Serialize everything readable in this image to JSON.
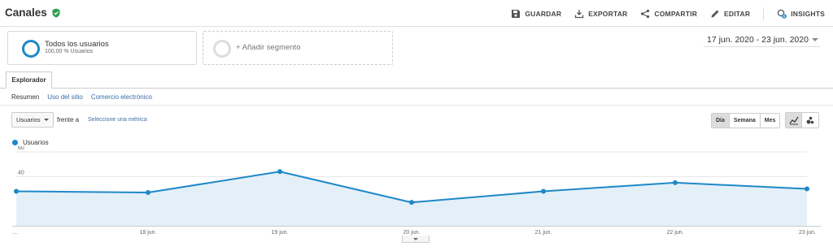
{
  "header": {
    "title": "Canales",
    "actions": [
      {
        "label": "GUARDAR",
        "icon": "save-icon"
      },
      {
        "label": "EXPORTAR",
        "icon": "export-icon"
      },
      {
        "label": "COMPARTIR",
        "icon": "share-icon"
      },
      {
        "label": "EDITAR",
        "icon": "edit-icon"
      },
      {
        "label": "INSIGHTS",
        "icon": "insights-icon",
        "badge": "5"
      }
    ]
  },
  "segments": {
    "active": {
      "title": "Todos los usuarios",
      "subtitle": "100,00 % Usuarios"
    },
    "add_label": "+ Añadir segmento"
  },
  "date_range": "17 jun. 2020 - 23 jun. 2020",
  "tab": "Explorador",
  "subtabs": [
    "Resumen",
    "Uso del sitio",
    "Comercio electrónico"
  ],
  "controls": {
    "metric": "Usuarios",
    "versus": "frente a",
    "pick_metric": "Seleccione una métrica",
    "period": [
      "Día",
      "Semana",
      "Mes"
    ],
    "active_period": "Día"
  },
  "colors": {
    "accent": "#1e88c8",
    "fill": "#e3f0f8",
    "check": "#2e9b4e"
  },
  "chart_data": {
    "type": "area",
    "series": [
      {
        "name": "Usuarios",
        "values": [
          28,
          27,
          44,
          19,
          28,
          35,
          30
        ]
      }
    ],
    "categories": [
      "…",
      "18 jun.",
      "19 jun.",
      "20 jun.",
      "21 jun.",
      "22 jun.",
      "23 jun."
    ],
    "yticks": [
      20,
      40,
      60
    ],
    "ylim": [
      0,
      60
    ],
    "grid": true
  }
}
